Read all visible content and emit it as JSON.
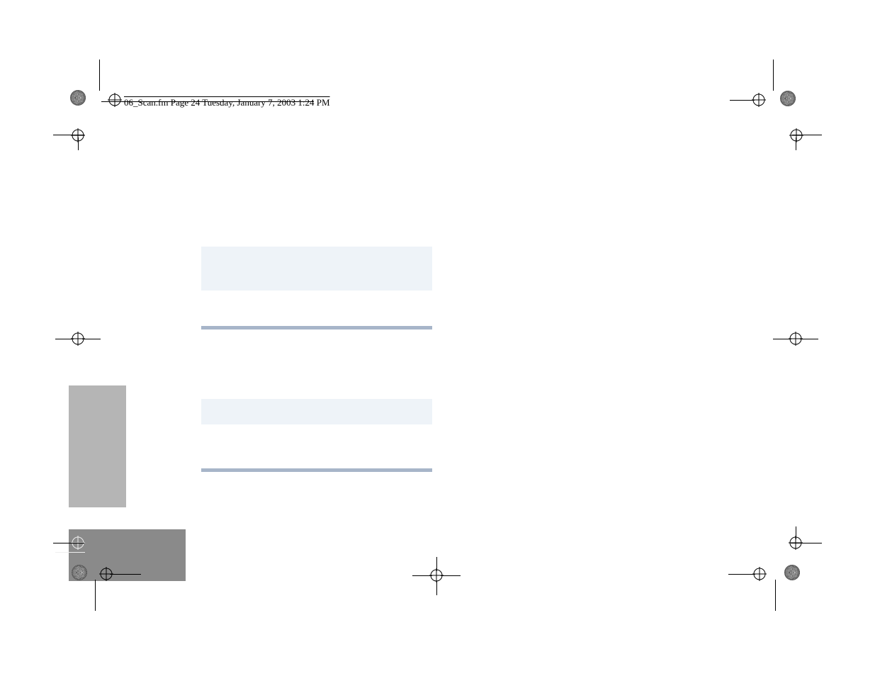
{
  "header": {
    "text": "06_Scan.fm  Page 24  Tuesday, January 7, 2003  1:24 PM"
  }
}
